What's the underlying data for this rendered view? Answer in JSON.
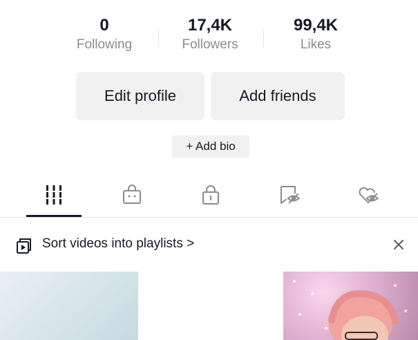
{
  "stats": {
    "following": {
      "value": "0",
      "label": "Following"
    },
    "followers": {
      "value": "17,4K",
      "label": "Followers"
    },
    "likes": {
      "value": "99,4K",
      "label": "Likes"
    }
  },
  "buttons": {
    "edit_profile": "Edit profile",
    "add_friends": "Add friends"
  },
  "bio": {
    "add_label": "+ Add bio"
  },
  "tabs": [
    {
      "name": "videos",
      "icon": "grid-bars-icon",
      "active": true
    },
    {
      "name": "shop",
      "icon": "shopping-bag-icon",
      "active": false
    },
    {
      "name": "private",
      "icon": "lock-icon",
      "active": false
    },
    {
      "name": "reposts",
      "icon": "bookmark-eye-icon",
      "active": false
    },
    {
      "name": "liked",
      "icon": "heart-eye-icon",
      "active": false
    }
  ],
  "banner": {
    "icon": "playlist-icon",
    "text": "Sort videos into playlists >",
    "close_icon": "close-icon"
  },
  "colors": {
    "text": "#161823",
    "secondary_text": "#8a8b91",
    "button_bg": "#f1f1f2"
  }
}
